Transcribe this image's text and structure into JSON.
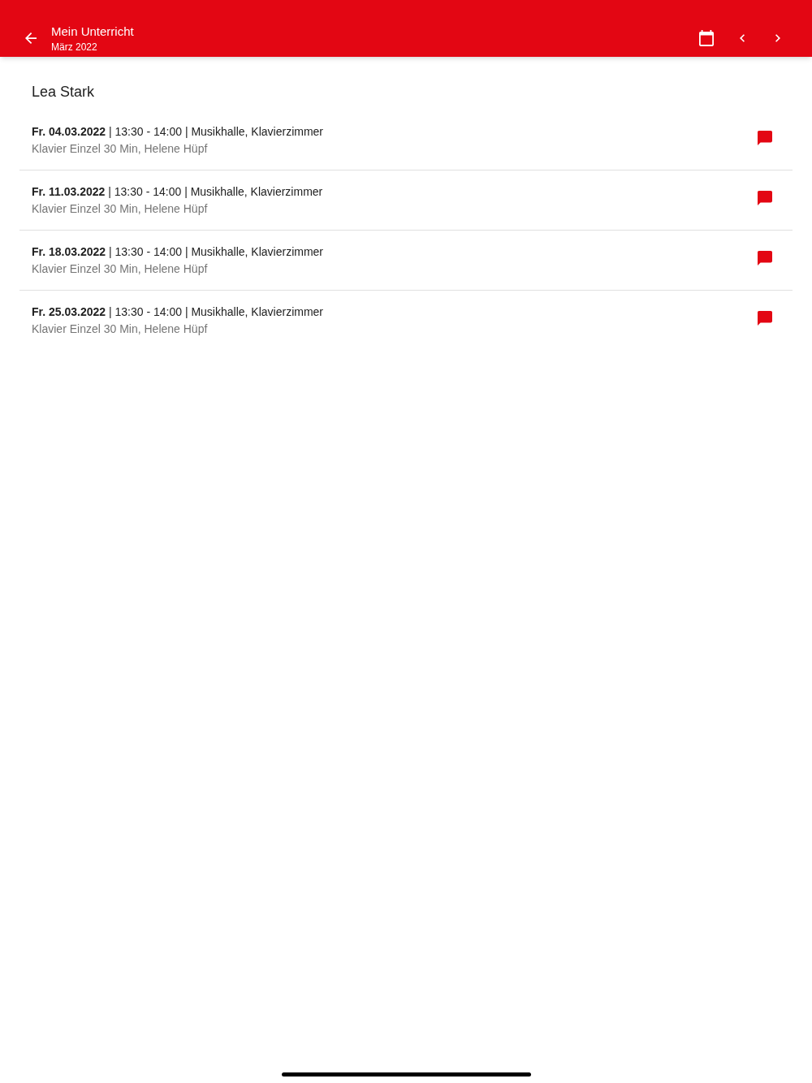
{
  "app_bar": {
    "title": "Mein Unterricht",
    "subtitle": "März 2022"
  },
  "student": {
    "name": "Lea Stark"
  },
  "lessons": [
    {
      "heading": "**Fr. 04.03.2022** | 13:30 - 14:00 | Musikhalle, Klavierzimmer",
      "details": "Klavier Einzel 30 Min, Helene Hüpf"
    },
    {
      "heading": "**Fr. 11.03.2022** | 13:30 - 14:00 | Musikhalle, Klavierzimmer",
      "details": "Klavier Einzel 30 Min, Helene Hüpf"
    },
    {
      "heading": "**Fr. 18.03.2022** | 13:30 - 14:00 | Musikhalle, Klavierzimmer",
      "details": "Klavier Einzel 30 Min, Helene Hüpf"
    },
    {
      "heading": "**Fr. 25.03.2022** | 13:30 - 14:00 | Musikhalle, Klavierzimmer",
      "details": "Klavier Einzel 30 Min, Helene Hüpf"
    }
  ]
}
